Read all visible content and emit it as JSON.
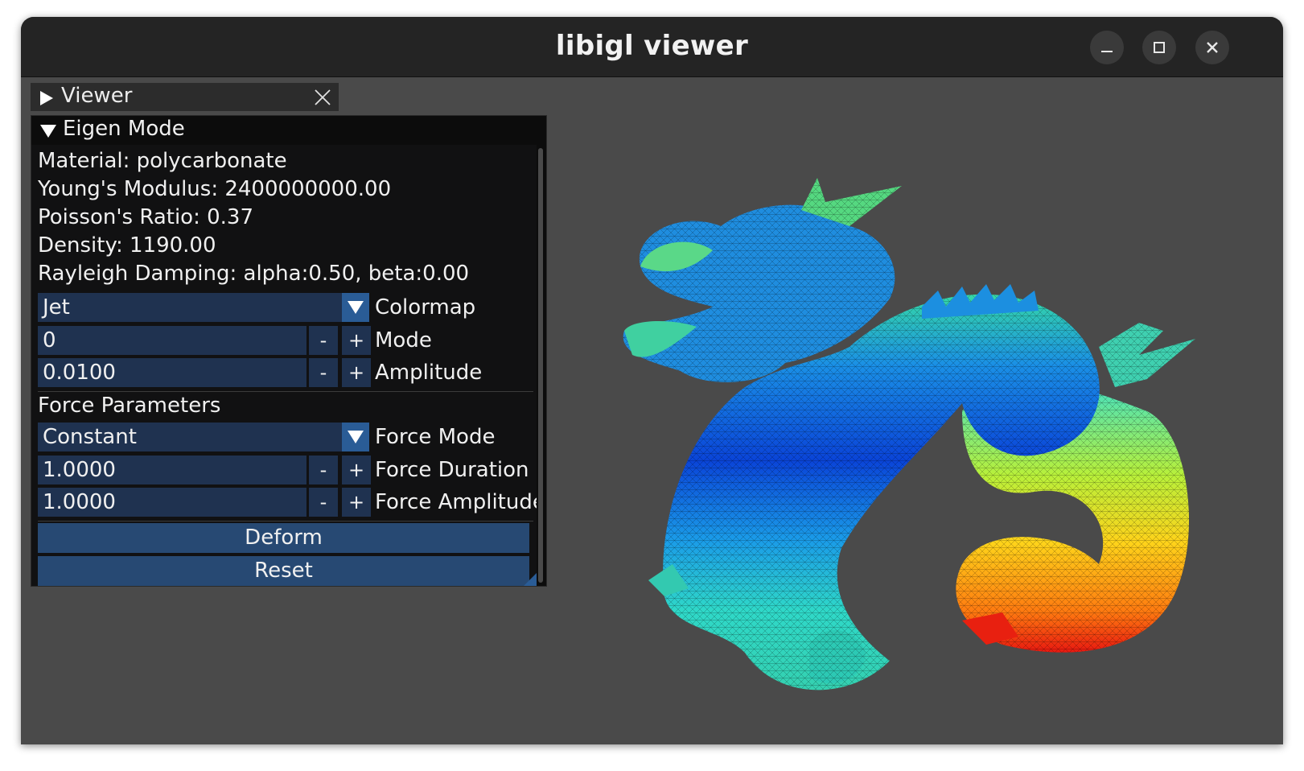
{
  "window": {
    "title": "libigl viewer",
    "controls": [
      "minimize-icon",
      "maximize-icon",
      "close-icon"
    ]
  },
  "viewer_tab": {
    "label": "Viewer",
    "close_icon": "close-icon"
  },
  "panel": {
    "header": "Eigen Mode",
    "info": {
      "material": "Material: polycarbonate",
      "youngs_modulus": "Young's Modulus: 2400000000.00",
      "poisson_ratio": "Poisson's Ratio: 0.37",
      "density": "Density: 1190.00",
      "rayleigh": "Rayleigh Damping: alpha:0.50, beta:0.00"
    },
    "colormap": {
      "value": "Jet",
      "label": "Colormap"
    },
    "mode": {
      "value": "0",
      "label": "Mode"
    },
    "amplitude": {
      "value": "0.0100",
      "label": "Amplitude"
    },
    "stepper": {
      "minus": "-",
      "plus": "+"
    },
    "force_section": "Force Parameters",
    "force_mode": {
      "value": "Constant",
      "label": "Force Mode"
    },
    "force_duration": {
      "value": "1.0000",
      "label": "Force Duration"
    },
    "force_amplitude": {
      "value": "1.0000",
      "label": "Force Amplitude"
    },
    "deform_button": "Deform",
    "reset_button": "Reset"
  },
  "colors": {
    "window_bg": "#4a4a4a",
    "panel_bg": "#111112",
    "field_bg": "#1f3250",
    "button_bg": "#274973",
    "accent": "#2a5c96"
  }
}
